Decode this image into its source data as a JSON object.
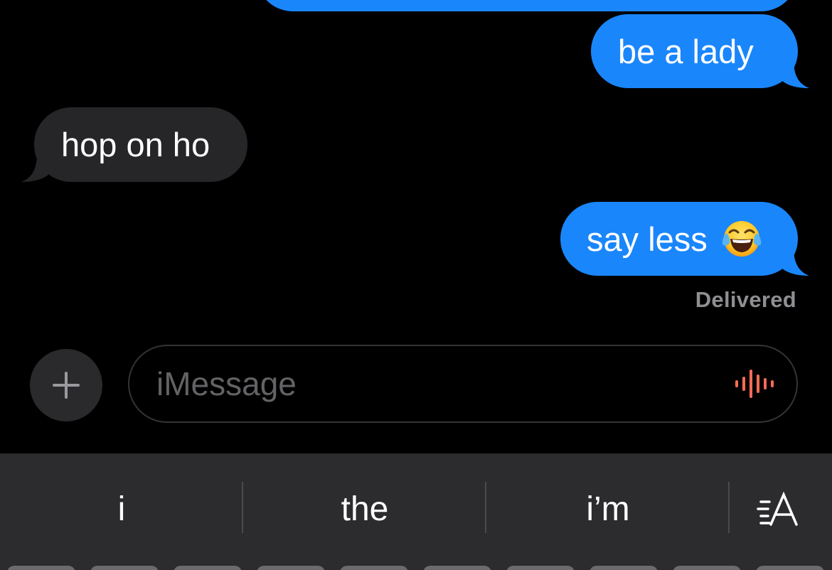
{
  "conversation": {
    "messages": [
      {
        "direction": "sent",
        "text": ""
      },
      {
        "direction": "sent",
        "text": "be a lady"
      },
      {
        "direction": "received",
        "text": "hop on ho"
      },
      {
        "direction": "sent",
        "text": "say less",
        "emoji": "face-with-tears-of-joy-icon"
      }
    ],
    "status": "Delivered"
  },
  "composer": {
    "placeholder": "iMessage",
    "value": "",
    "plus_icon": "plus-icon",
    "audio_icon": "audio-waveform-icon"
  },
  "keyboard": {
    "predictions": [
      "i",
      "the",
      "i’m"
    ],
    "text_effects_icon": "text-effects-icon"
  },
  "colors": {
    "sent_bubble": "#1a86fb",
    "received_bubble": "#262628",
    "background": "#000000",
    "status_text": "#8e8e93",
    "audio_accent": "#ff6b57",
    "keyboard_bg": "#2c2c2e"
  }
}
